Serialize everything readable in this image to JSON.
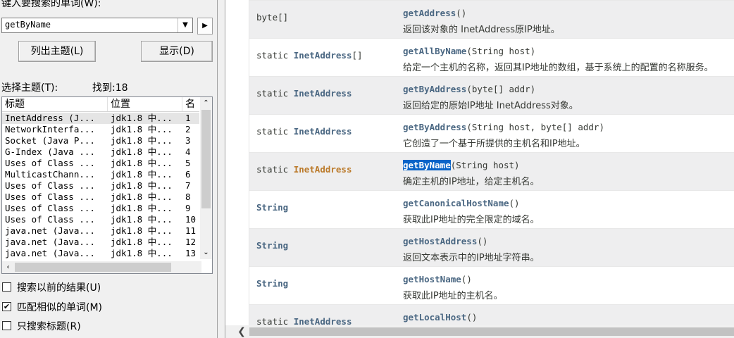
{
  "search": {
    "keyword_label": "键入要搜索的单词(W):",
    "value": "getByName",
    "list_topics_btn": "列出主题(L)",
    "display_btn": "显示(D)",
    "select_topic_label": "选择主题(T):",
    "found_label": "找到:18"
  },
  "results": {
    "columns": [
      "标题",
      "位置",
      "名"
    ],
    "rows": [
      {
        "title": "InetAddress (J...",
        "location": "jdk1.8 中...",
        "rank": "1"
      },
      {
        "title": "NetworkInterfa...",
        "location": "jdk1.8 中...",
        "rank": "2"
      },
      {
        "title": "Socket (Java P...",
        "location": "jdk1.8 中...",
        "rank": "3"
      },
      {
        "title": "G-Index (Java ...",
        "location": "jdk1.8 中...",
        "rank": "4"
      },
      {
        "title": "Uses of Class ...",
        "location": "jdk1.8 中...",
        "rank": "5"
      },
      {
        "title": "MulticastChann...",
        "location": "jdk1.8 中...",
        "rank": "6"
      },
      {
        "title": "Uses of Class ...",
        "location": "jdk1.8 中...",
        "rank": "7"
      },
      {
        "title": "Uses of Class ...",
        "location": "jdk1.8 中...",
        "rank": "8"
      },
      {
        "title": "Uses of Class ...",
        "location": "jdk1.8 中...",
        "rank": "9"
      },
      {
        "title": "Uses of Class ...",
        "location": "jdk1.8 中...",
        "rank": "10"
      },
      {
        "title": "java.net (Java...",
        "location": "jdk1.8 中...",
        "rank": "11"
      },
      {
        "title": "java.net (Java...",
        "location": "jdk1.8 中...",
        "rank": "12"
      },
      {
        "title": "java.net (Java...",
        "location": "jdk1.8 中...",
        "rank": "13"
      }
    ]
  },
  "options": [
    {
      "label": "搜索以前的结果(U)",
      "checked": false
    },
    {
      "label": "匹配相似的单词(M)",
      "checked": true
    },
    {
      "label": "只搜索标题(R)",
      "checked": false
    }
  ],
  "methods": [
    {
      "modifier": "byte[]",
      "type": "",
      "type_suffix": "",
      "name": "getAddress",
      "params": "()",
      "desc": "返回该对象的 InetAddress原IP地址。"
    },
    {
      "modifier": "static ",
      "type": "InetAddress",
      "type_suffix": "[]",
      "name": "getAllByName",
      "params": "(String host)",
      "desc": "给定一个主机的名称，返回其IP地址的数组，基于系统上的配置的名称服务。"
    },
    {
      "modifier": "static ",
      "type": "InetAddress",
      "type_suffix": "",
      "name": "getByAddress",
      "params": "(byte[] addr)",
      "desc": "返回给定的原始IP地址 InetAddress对象。"
    },
    {
      "modifier": "static ",
      "type": "InetAddress",
      "type_suffix": "",
      "name": "getByAddress",
      "params": "(String host, byte[] addr)",
      "desc": "它创造了一个基于所提供的主机名和IP地址。"
    },
    {
      "modifier": "static ",
      "type": "InetAddress",
      "type_suffix": "",
      "name": "getByName",
      "params": "(String host)",
      "desc": "确定主机的IP地址，给定主机名。"
    },
    {
      "modifier": "",
      "type": "String",
      "type_suffix": "",
      "name": "getCanonicalHostName",
      "params": "()",
      "desc": "获取此IP地址的完全限定的域名。"
    },
    {
      "modifier": "",
      "type": "String",
      "type_suffix": "",
      "name": "getHostAddress",
      "params": "()",
      "desc": "返回文本表示中的IP地址字符串。"
    },
    {
      "modifier": "",
      "type": "String",
      "type_suffix": "",
      "name": "getHostName",
      "params": "()",
      "desc": "获取此IP地址的主机名。"
    },
    {
      "modifier": "static ",
      "type": "InetAddress",
      "type_suffix": "",
      "name": "getLocalHost",
      "params": "()",
      "desc": ""
    }
  ],
  "highlight": {
    "method_index": 4,
    "color": "#0a64c8",
    "type_color": "#bb7a2a"
  }
}
